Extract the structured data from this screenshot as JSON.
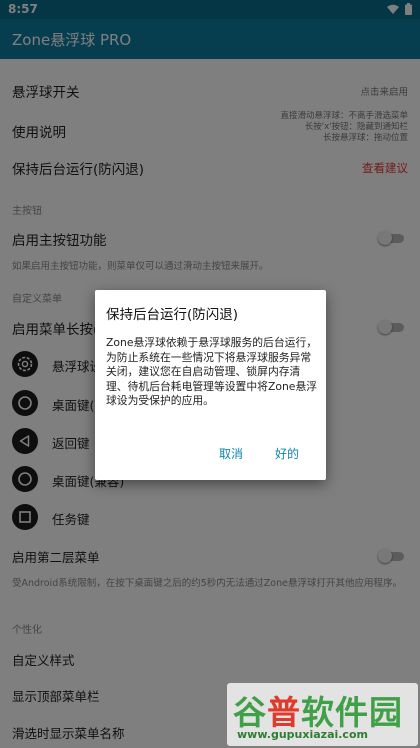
{
  "status": {
    "time": "8:57"
  },
  "appbar": {
    "title": "Zone悬浮球 PRO"
  },
  "rows": {
    "float_switch": {
      "label": "悬浮球开关",
      "hint": "点击来启用"
    },
    "instructions": {
      "label": "使用说明",
      "hint_lines": [
        "直接滑动悬浮球：不离手滑选菜单",
        "长按'x'按钮：隐藏到通知栏",
        "长按悬浮球：拖动位置"
      ]
    },
    "keep_alive": {
      "label": "保持后台运行(防闪退)",
      "hint": "查看建议"
    },
    "section_main_button": "主按钮",
    "enable_main_button": {
      "label": "启用主按钮功能"
    },
    "main_button_desc": "如果启用主按钮功能，则菜单仅可以通过滑动主按钮来展开。",
    "section_custom_menu": "自定义菜单",
    "menu_long_press": {
      "label": "启用菜单长按("
    },
    "menu_items": [
      {
        "label": "悬浮球设",
        "icon": "gear-icon"
      },
      {
        "label": "桌面键(",
        "icon": "circle-outline-icon"
      },
      {
        "label": "返回键",
        "icon": "back-triangle-icon"
      },
      {
        "label": "桌面键(兼容)",
        "icon": "circle-outline-icon"
      },
      {
        "label": "任务键",
        "icon": "square-icon"
      }
    ],
    "second_menu": {
      "label": "启用第二层菜单"
    },
    "second_menu_desc": "受Android系统限制，在按下桌面键之后的约5秒内无法通过Zone悬浮球打开其他应用程序。",
    "section_personalize": "个性化",
    "custom_style": {
      "label": "自定义样式"
    },
    "show_top_menu": {
      "label": "显示顶部菜单栏"
    },
    "show_menu_names": {
      "label": "滑选时显示菜单名称"
    }
  },
  "dialog": {
    "title": "保持后台运行(防闪退)",
    "body": "Zone悬浮球依赖于悬浮球服务的后台运行，为防止系统在一些情况下将悬浮球服务异常关闭，建议您在自启动管理、锁屏内存清理、待机后台耗电管理等设置中将Zone悬浮球设为受保护的应用。",
    "cancel": "取消",
    "ok": "好的"
  },
  "watermark": {
    "brand_green_1": "谷",
    "brand_red": "普",
    "brand_green_2": "软件园",
    "url": "www.gupuxiazai.com"
  },
  "colors": {
    "status_bar": "#0b6c8a",
    "app_bar": "#0e7c9e",
    "accent_link": "#0e86b3",
    "warning_text": "#e53935"
  }
}
